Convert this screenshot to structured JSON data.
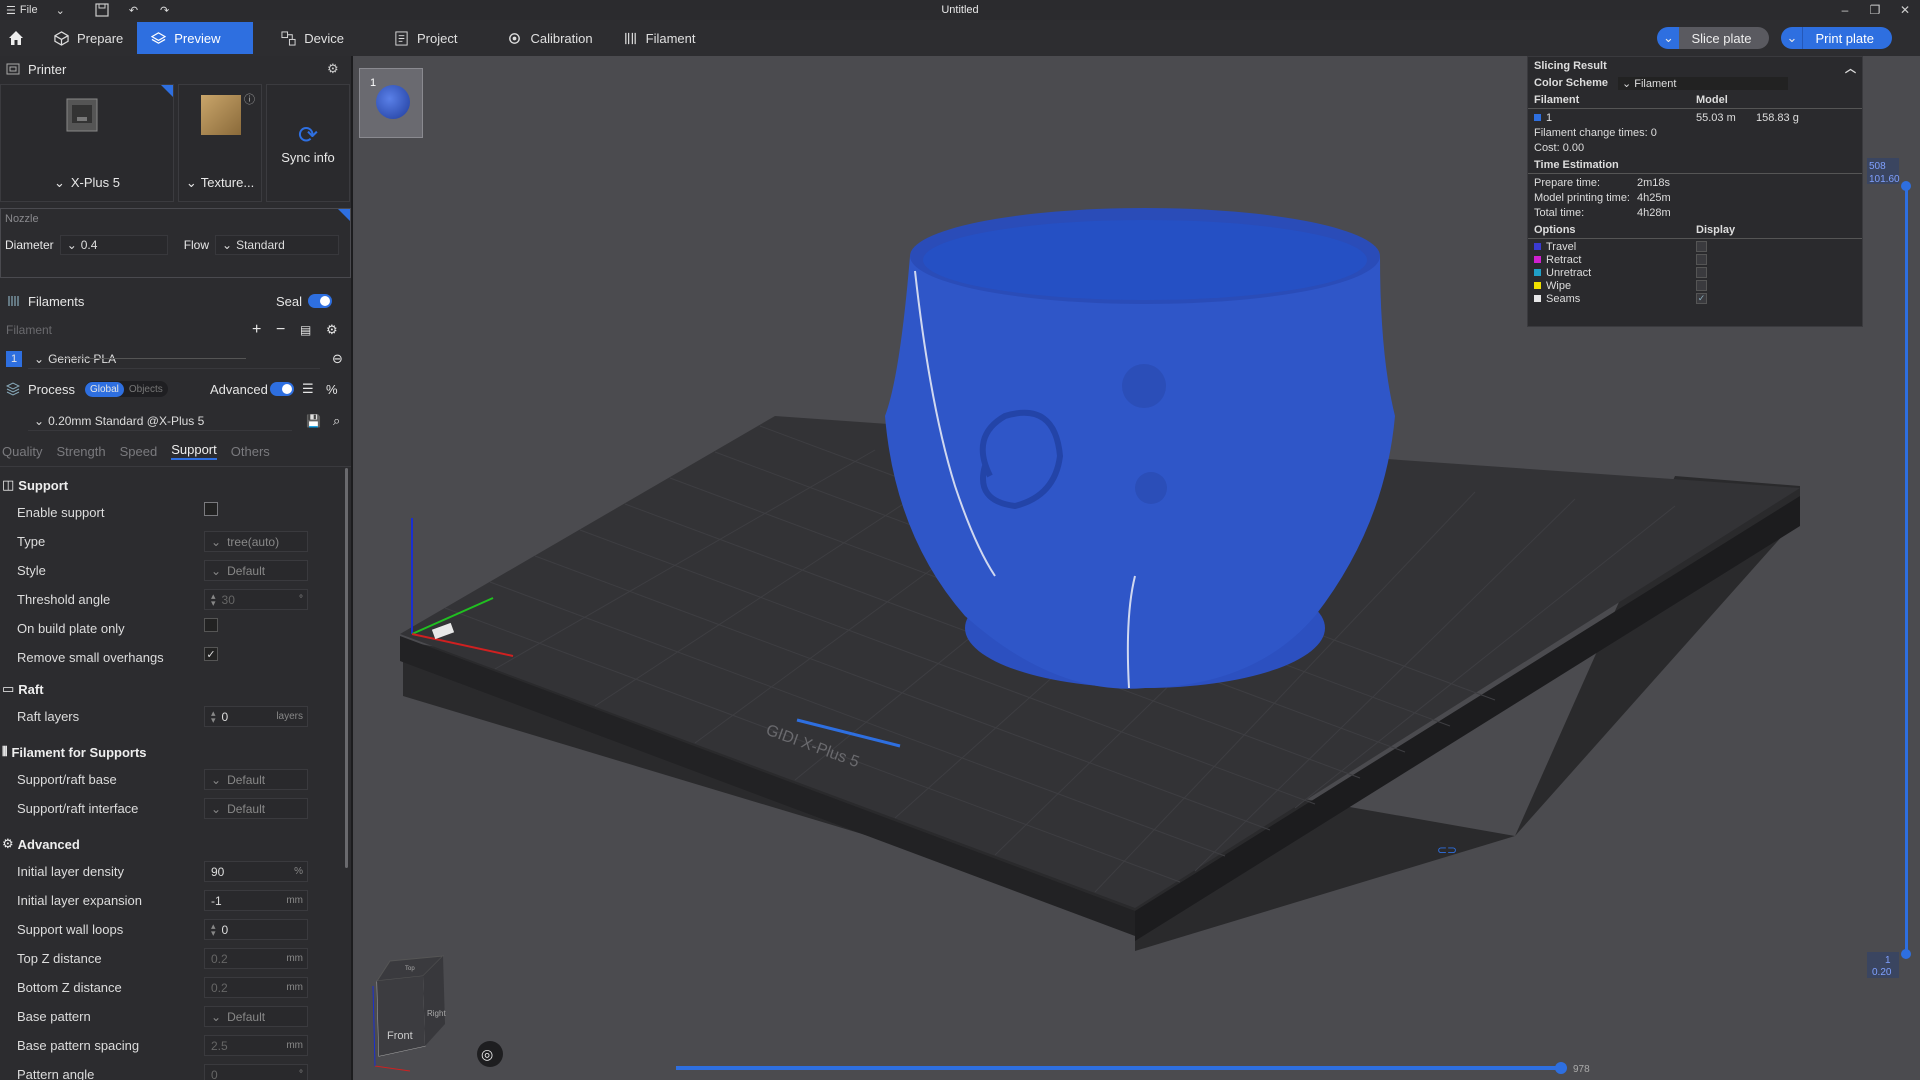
{
  "titlebar": {
    "file_label": "File",
    "title": "Untitled"
  },
  "tabs": [
    {
      "label": "Prepare"
    },
    {
      "label": "Preview"
    },
    {
      "label": "Device"
    },
    {
      "label": "Project"
    },
    {
      "label": "Calibration"
    },
    {
      "label": "Filament"
    }
  ],
  "actions": {
    "slice": "Slice plate",
    "print": "Print plate"
  },
  "printer": {
    "section": "Printer",
    "model": "X-Plus 5",
    "plate": "Texture...",
    "sync": "Sync info"
  },
  "nozzle": {
    "title": "Nozzle",
    "diameter_label": "Diameter",
    "diameter_value": "0.4",
    "flow_label": "Flow",
    "flow_value": "Standard"
  },
  "filaments": {
    "section": "Filaments",
    "seal_label": "Seal",
    "filament_label": "Filament",
    "slot": "1",
    "name": "Generic PLA"
  },
  "process": {
    "section": "Process",
    "global": "Global",
    "objects": "Objects",
    "advanced": "Advanced",
    "preset": "0.20mm Standard @X-Plus 5",
    "subtabs": [
      "Quality",
      "Strength",
      "Speed",
      "Support",
      "Others"
    ]
  },
  "support_group": {
    "title": "Support",
    "enable_support": "Enable support",
    "type_label": "Type",
    "type_value": "tree(auto)",
    "style_label": "Style",
    "style_value": "Default",
    "threshold_label": "Threshold angle",
    "threshold_value": "30",
    "threshold_unit": "°",
    "build_plate_only": "On build plate only",
    "remove_small": "Remove small overhangs"
  },
  "raft_group": {
    "title": "Raft",
    "layers_label": "Raft layers",
    "layers_value": "0",
    "layers_unit": "layers"
  },
  "filament_supports": {
    "title": "Filament for Supports",
    "base_label": "Support/raft base",
    "base_value": "Default",
    "interface_label": "Support/raft interface",
    "interface_value": "Default"
  },
  "advanced_group": {
    "title": "Advanced",
    "density_label": "Initial layer density",
    "density_value": "90",
    "density_unit": "%",
    "expansion_label": "Initial layer expansion",
    "expansion_value": "-1",
    "expansion_unit": "mm",
    "wall_loops_label": "Support wall loops",
    "wall_loops_value": "0",
    "topz_label": "Top Z distance",
    "topz_value": "0.2",
    "topz_unit": "mm",
    "bottomz_label": "Bottom Z distance",
    "bottomz_value": "0.2",
    "bottomz_unit": "mm",
    "base_pattern_label": "Base pattern",
    "base_pattern_value": "Default",
    "spacing_label": "Base pattern spacing",
    "spacing_value": "2.5",
    "spacing_unit": "mm",
    "angle_label": "Pattern angle",
    "angle_value": "0",
    "angle_unit": "°"
  },
  "slicing_result": {
    "title": "Slicing Result",
    "color_scheme_label": "Color Scheme",
    "color_scheme_value": "Filament",
    "col_filament": "Filament",
    "col_model": "Model",
    "filament_id": "1",
    "length": "55.03 m",
    "weight": "158.83 g",
    "change_times": "Filament change times: 0",
    "cost": "Cost: 0.00",
    "time_title": "Time Estimation",
    "prepare_label": "Prepare time:",
    "prepare_value": "2m18s",
    "model_time_label": "Model printing time:",
    "model_time_value": "4h25m",
    "total_label": "Total time:",
    "total_value": "4h28m",
    "options_title": "Options",
    "display_title": "Display",
    "options": [
      {
        "label": "Travel",
        "color": "#3a3ad0"
      },
      {
        "label": "Retract",
        "color": "#d020d0"
      },
      {
        "label": "Unretract",
        "color": "#20a0c8"
      },
      {
        "label": "Wipe",
        "color": "#f0e000"
      },
      {
        "label": "Seams",
        "color": "#e8e8e8"
      }
    ]
  },
  "viewport": {
    "plate_number": "1",
    "layer_top": "508",
    "height_top": "101.60",
    "layer_bottom": "1",
    "height_bottom": "0.20",
    "move_value": "978",
    "brand_text": "GIDI X-Plus 5",
    "cube_front": "Front",
    "cube_right": "Right",
    "cube_top": "Top"
  },
  "colors": {
    "accent": "#2e6fe0",
    "model": "#2f56c8"
  }
}
